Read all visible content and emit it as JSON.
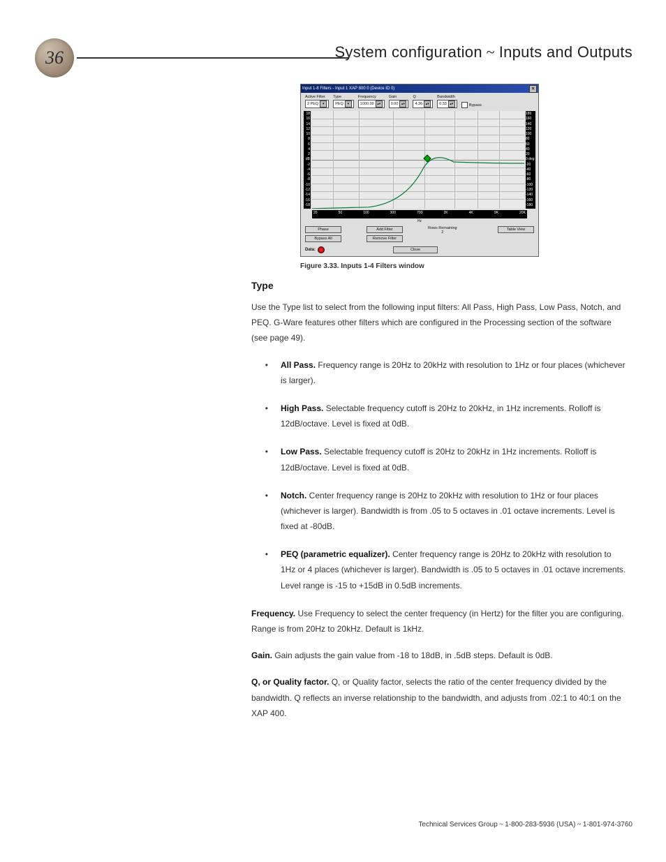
{
  "page_number": "36",
  "header_title_a": "System configuration",
  "header_title_sep": " ~ ",
  "header_title_b": "Inputs and Outputs",
  "window": {
    "title": "Input 1-8 Filters - Input 1  XAP 800 0 (Device ID 0)",
    "active_filter": {
      "label": "Active Filter",
      "value": "2 PEQ"
    },
    "type": {
      "label": "Type",
      "value": "PEQ"
    },
    "frequency": {
      "label": "Frequency",
      "value": "1000.00"
    },
    "gain": {
      "label": "Gain",
      "value": "0.00"
    },
    "q": {
      "label": "Q",
      "value": "4.36"
    },
    "bandwidth": {
      "label": "Bandwidth",
      "value": "0.33"
    },
    "bypass": {
      "label": "Bypass"
    },
    "y_left": [
      "18",
      "16",
      "14",
      "12",
      "10",
      "8",
      "6",
      "4",
      "2",
      "dB",
      "-2",
      "-4",
      "-6",
      "-8",
      "-10",
      "-12",
      "-14",
      "-16",
      "-18"
    ],
    "y_right": [
      "180",
      "160",
      "140",
      "120",
      "100",
      "80",
      "60",
      "40",
      "20",
      "0 deg",
      "-20",
      "-40",
      "-60",
      "-80",
      "-100",
      "-120",
      "-140",
      "-160",
      "-180"
    ],
    "x_ticks": [
      "20",
      "50",
      "100",
      "300",
      "700",
      "2K",
      "4K",
      "9K",
      "20K"
    ],
    "x_unit": "Hz",
    "buttons": {
      "phase": "Phase",
      "bypass_all": "Bypass All",
      "add": "Add Filter",
      "remove": "Remove Filter",
      "table": "Table View",
      "close": "Close"
    },
    "rows_remaining_label": "Rows Remaining",
    "rows_remaining_value": "2",
    "data_label": "Data:"
  },
  "figure_caption": "Figure 3.33. Inputs 1-4 Filters window",
  "section_heading": "Type",
  "intro_paragraph": "Use the Type list to select from the following input filters: All Pass, High Pass, Low Pass, Notch, and PEQ. G-Ware features other filters which are configured in the Processing section of the software (see page 49).",
  "bullets": [
    {
      "title": "All Pass.",
      "body": " Frequency range is 20Hz to 20kHz with resolution to 1Hz or four places (whichever is larger)."
    },
    {
      "title": "High Pass.",
      "body": " Selectable frequency cutoff is 20Hz to 20kHz, in 1Hz increments. Rolloff is 12dB/octave. Level is fixed at 0dB."
    },
    {
      "title": "Low Pass.",
      "body": " Selectable frequency cutoff is 20Hz to 20kHz in 1Hz increments. Rolloff is 12dB/octave. Level is fixed at 0dB."
    },
    {
      "title": "Notch.",
      "body": " Center frequency range is 20Hz to 20kHz with resolution to 1Hz or four places (whichever is larger). Bandwidth is from .05 to 5 octaves in .01 octave increments. Level is fixed at -80dB."
    },
    {
      "title": "PEQ (parametric equalizer).",
      "body": " Center frequency range is 20Hz to 20kHz with resolution to 1Hz or 4 places (whichever is larger). Bandwidth is .05 to 5 octaves in .01 octave increments. Level range is -15 to +15dB in 0.5dB increments."
    }
  ],
  "paragraphs": [
    {
      "title": "Frequency.",
      "body": " Use Frequency to select the center frequency (in Hertz) for the filter you are configuring. Range is from 20Hz to 20kHz. Default is 1kHz."
    },
    {
      "title": "Gain.",
      "body": " Gain adjusts the gain value from -18 to 18dB, in .5dB steps. Default is 0dB."
    },
    {
      "title": "Q, or Quality factor.",
      "body": " Q, or Quality factor, selects the ratio of the center frequency divided by the bandwidth. Q reflects an inverse relationship to the bandwidth, and adjusts from .02:1 to 40:1 on the XAP 400."
    }
  ],
  "footer": {
    "a": "Technical Services Group",
    "sep": " ~ ",
    "b": "1-800-283-5936 (USA)",
    "c": "1-801-974-3760"
  }
}
